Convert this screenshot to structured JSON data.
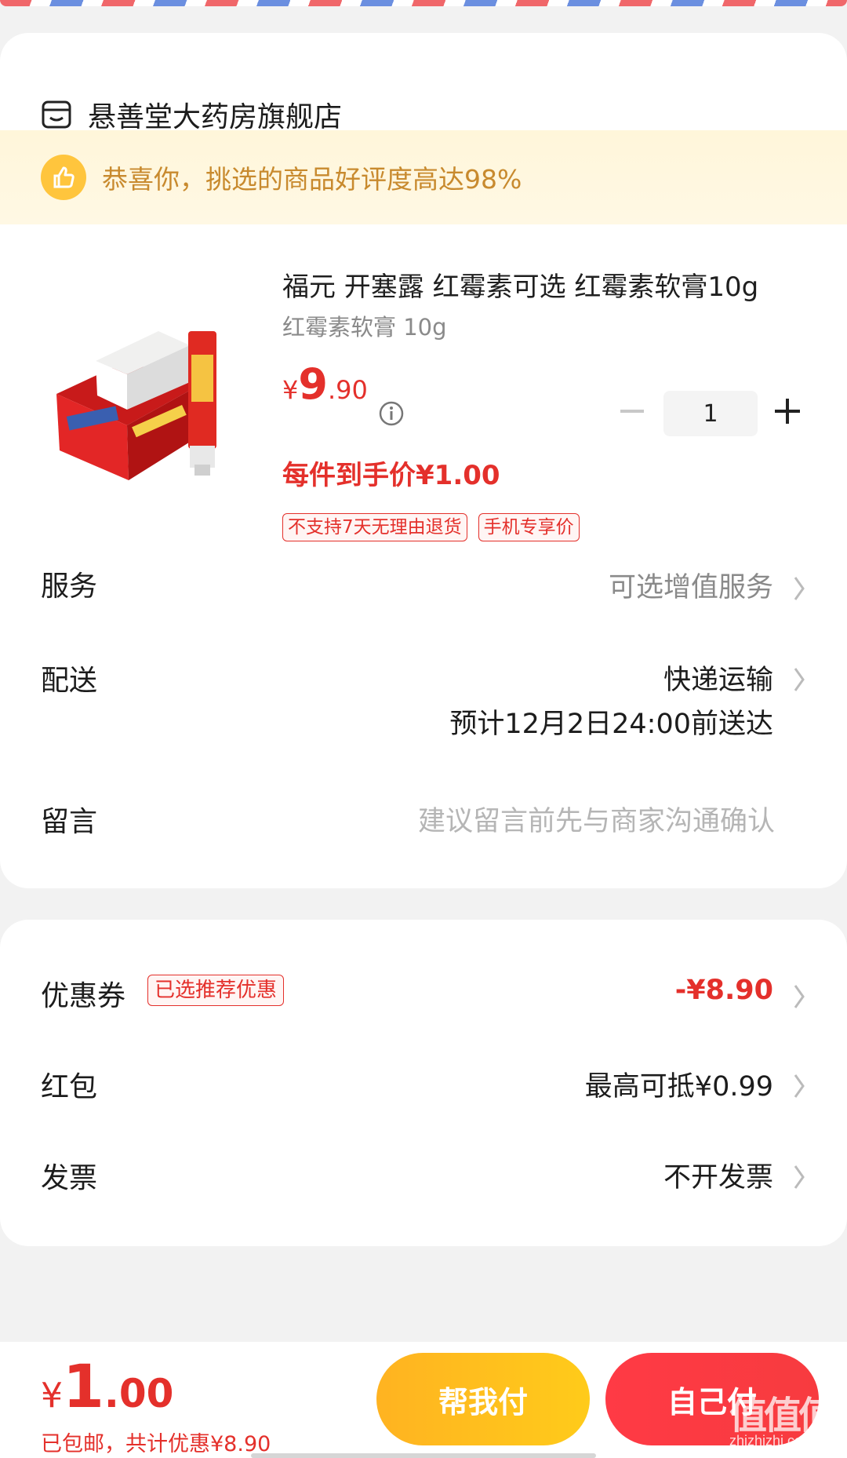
{
  "store": {
    "name": "悬善堂大药房旗舰店"
  },
  "banner": {
    "text": "恭喜你，挑选的商品好评度高达98%"
  },
  "product": {
    "title": "福元 开塞露 红霉素可选 红霉素软膏10g",
    "spec": "红霉素软膏 10g",
    "price_yen": "¥",
    "price_int": "9",
    "price_dec": ".90",
    "quantity": "1",
    "net_price": "每件到手价¥1.00",
    "tags": [
      "不支持7天无理由退货",
      "手机专享价"
    ]
  },
  "rows": {
    "service": {
      "label": "服务",
      "value": "可选增值服务"
    },
    "delivery": {
      "label": "配送",
      "value": "快递运输",
      "eta": "预计12月2日24:00前送达"
    },
    "message": {
      "label": "留言",
      "placeholder": "建议留言前先与商家沟通确认"
    }
  },
  "discounts": {
    "coupon": {
      "label": "优惠券",
      "tag": "已选推荐优惠",
      "value": "-¥8.90"
    },
    "redpacket": {
      "label": "红包",
      "value": "最高可抵¥0.99"
    },
    "invoice": {
      "label": "发票",
      "value": "不开发票"
    }
  },
  "bottom": {
    "total_yen": "¥",
    "total_int": "1",
    "total_dec": ".00",
    "note": "已包邮，共计优惠¥8.90",
    "help_pay": "帮我付",
    "self_pay": "自己付"
  },
  "watermark": {
    "glyph": "值值值",
    "text": "zhizhizhi.com"
  },
  "colors": {
    "accent_red": "#e4302b",
    "help_button": "#ffbe1e",
    "self_button": "#f93b42",
    "banner_bg": "#fff6da"
  }
}
